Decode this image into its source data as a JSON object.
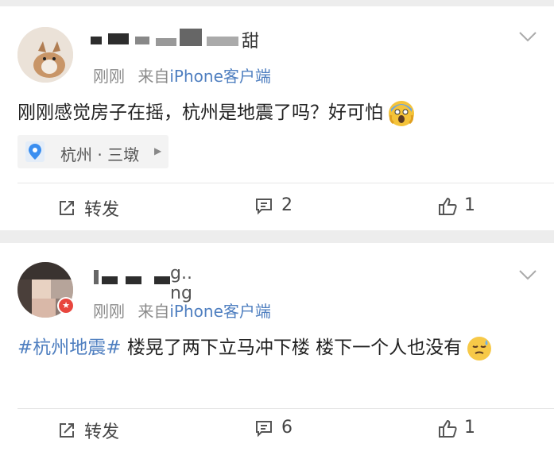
{
  "posts": [
    {
      "username": "甜",
      "time": "刚刚",
      "source_prefix": "来自",
      "source_device": "iPhone客户端",
      "text": "刚刚感觉房子在摇，杭州是地震了吗？好可怕",
      "emoji": "scream-emoji",
      "location": "杭州 · 三墩",
      "repost_label": "转发",
      "comment_count": "2",
      "like_count": "1"
    },
    {
      "username": "g.. ng",
      "time": "刚刚",
      "source_prefix": "来自",
      "source_device": "iPhone客户端",
      "hashtag": "#杭州地震#",
      "text": " 楼晃了两下立马冲下楼 楼下一个人也没有",
      "emoji": "sweat-emoji",
      "repost_label": "转发",
      "comment_count": "6",
      "like_count": "1"
    }
  ],
  "colors": {
    "link_blue": "#4f7fc0",
    "badge_red": "#e8463e",
    "background": "#ededed"
  }
}
